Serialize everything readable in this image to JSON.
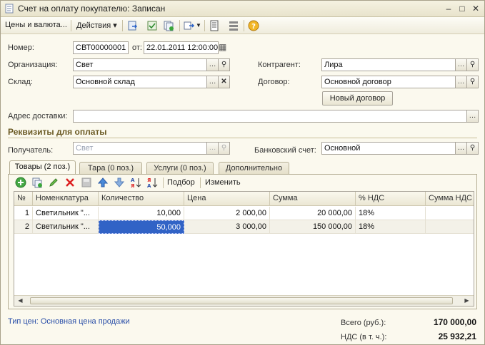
{
  "window": {
    "title": "Счет на оплату покупателю: Записан"
  },
  "toolbar": {
    "prices_currency": "Цены и валюта...",
    "actions": "Действия"
  },
  "form": {
    "number_label": "Номер:",
    "number_value": "СВТ00000001",
    "date_label": "от:",
    "date_value": "22.01.2011 12:00:00",
    "org_label": "Организация:",
    "org_value": "Свет",
    "counterparty_label": "Контрагент:",
    "counterparty_value": "Лира",
    "warehouse_label": "Склад:",
    "warehouse_value": "Основной склад",
    "contract_label": "Договор:",
    "contract_value": "Основной договор",
    "new_contract_button": "Новый договор",
    "address_label": "Адрес доставки:",
    "address_value": ""
  },
  "payment": {
    "section_title": "Реквизиты для оплаты",
    "recipient_label": "Получатель:",
    "recipient_value": "Свет",
    "bank_label": "Банковский счет:",
    "bank_value": "Основной"
  },
  "tabs": [
    {
      "label": "Товары (2 поз.)"
    },
    {
      "label": "Тара (0 поз.)"
    },
    {
      "label": "Услуги (0 поз.)"
    },
    {
      "label": "Дополнительно"
    }
  ],
  "table_toolbar": {
    "pick": "Подбор",
    "change": "Изменить"
  },
  "table": {
    "headers": [
      "№",
      "Номенклатура",
      "Количество",
      "Цена",
      "Сумма",
      "% НДС",
      "Сумма НДС"
    ],
    "rows": [
      {
        "n": "1",
        "item": "Светильник \"...",
        "qty": "10,000",
        "price": "2 000,00",
        "sum": "20 000,00",
        "vat": "18%",
        "vat_sum": ""
      },
      {
        "n": "2",
        "item": "Светильник \"...",
        "qty": "50,000",
        "price": "3 000,00",
        "sum": "150 000,00",
        "vat": "18%",
        "vat_sum": ""
      }
    ]
  },
  "footer": {
    "price_type_link": "Тип цен: Основная цена продажи",
    "total_label": "Всего (руб.):",
    "total_value": "170 000,00",
    "vat_label": "НДС (в т. ч.):",
    "vat_value": "25 932,21"
  },
  "colors": {
    "selection": "#3163c6",
    "section": "#6b5a24",
    "link": "#2a4fa8"
  }
}
